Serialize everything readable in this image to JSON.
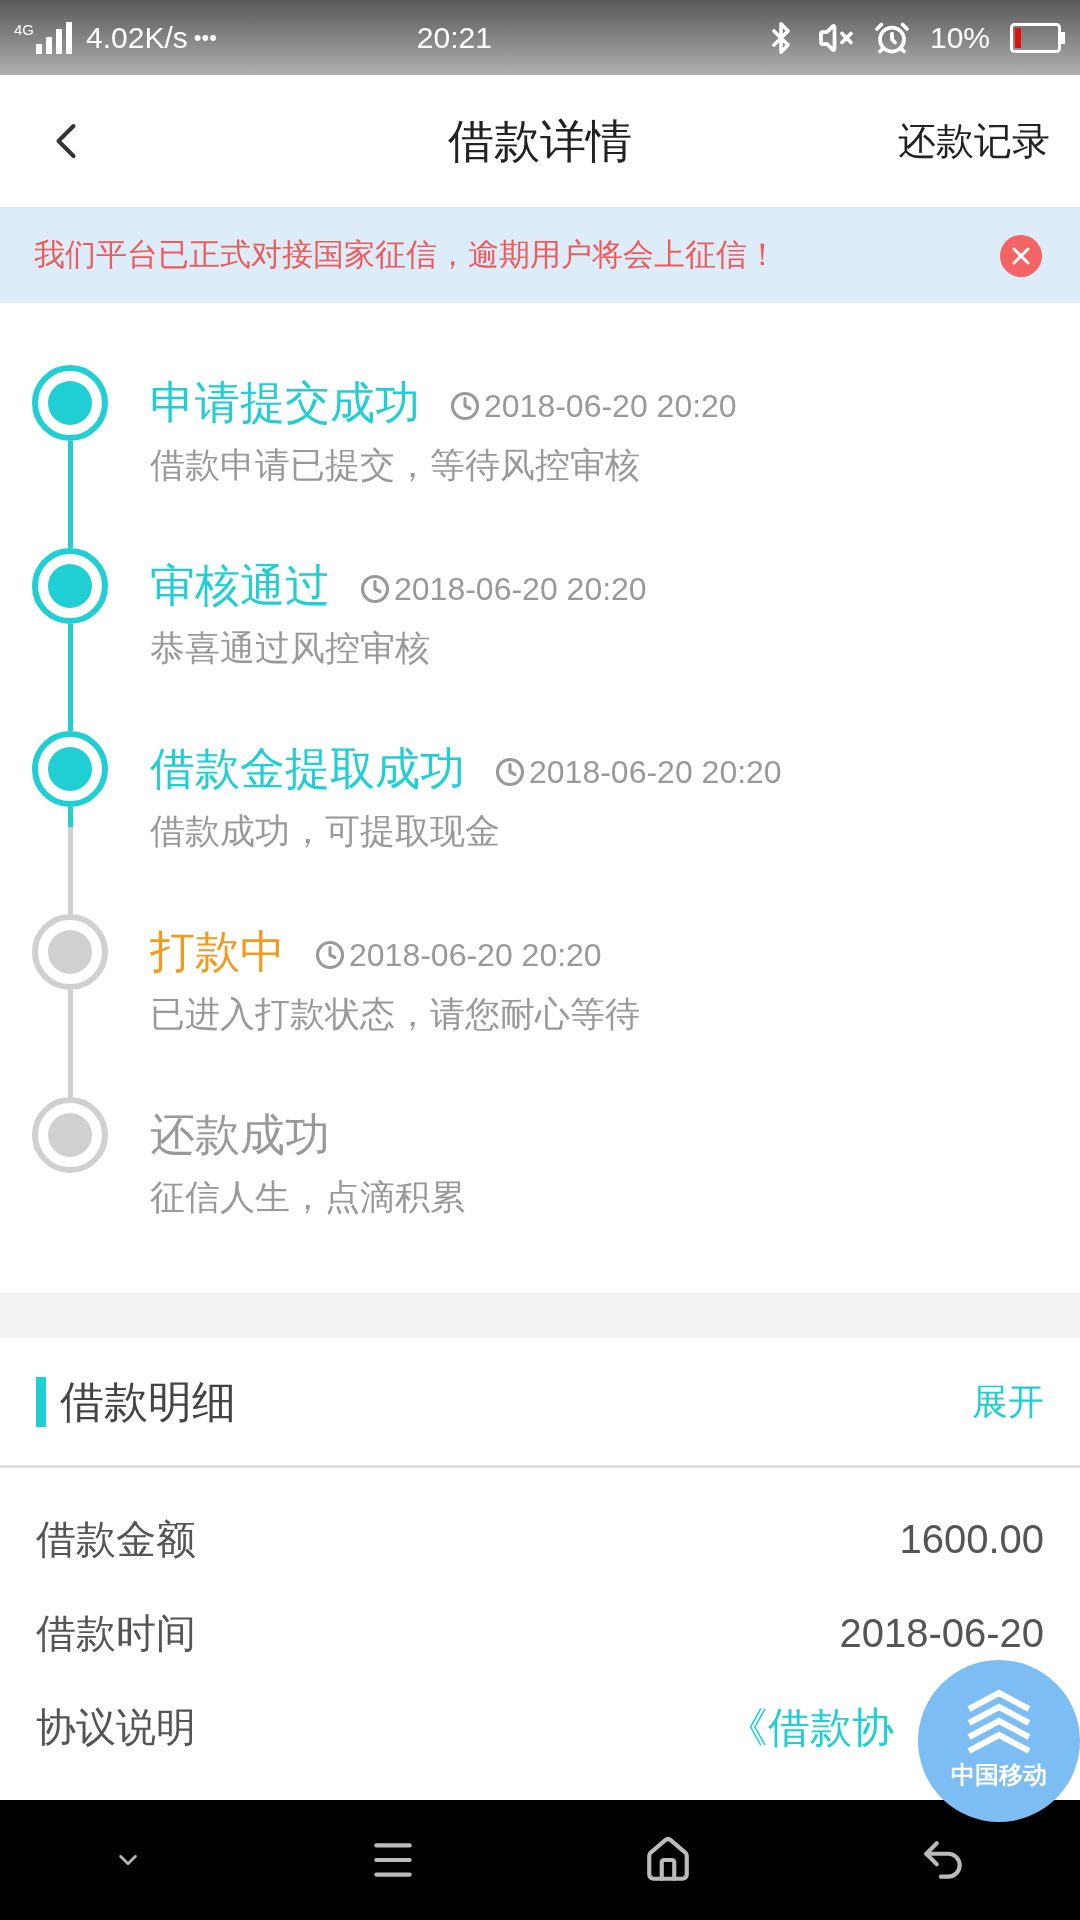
{
  "status_bar": {
    "network": "4G",
    "speed": "4.02K/s",
    "dots": "•••",
    "time": "20:21",
    "battery": "10%"
  },
  "header": {
    "title": "借款详情",
    "action": "还款记录"
  },
  "notice": {
    "text": "我们平台已正式对接国家征信，逾期用户将会上征信！"
  },
  "timeline": [
    {
      "title": "申请提交成功",
      "time": "2018-06-20 20:20",
      "subtitle": "借款申请已提交，等待风控审核",
      "completed": true,
      "in_progress": false
    },
    {
      "title": "审核通过",
      "time": "2018-06-20 20:20",
      "subtitle": "恭喜通过风控审核",
      "completed": true,
      "in_progress": false
    },
    {
      "title": "借款金提取成功",
      "time": "2018-06-20 20:20",
      "subtitle": "借款成功，可提取现金",
      "completed": true,
      "in_progress": false
    },
    {
      "title": "打款中",
      "time": "2018-06-20 20:20",
      "subtitle": "已进入打款状态，请您耐心等待",
      "completed": false,
      "in_progress": true
    },
    {
      "title": "还款成功",
      "subtitle": "征信人生，点滴积累",
      "completed": false,
      "in_progress": false
    }
  ],
  "details": {
    "title": "借款明细",
    "toggle": "展开",
    "rows": [
      {
        "label": "借款金额",
        "value": "1600.00",
        "kind": "text"
      },
      {
        "label": "借款时间",
        "value": "2018-06-20",
        "kind": "text"
      },
      {
        "label": "协议说明",
        "value": "《借款协",
        "kind": "link"
      }
    ]
  },
  "floating_badge": {
    "label": "中国移动"
  }
}
